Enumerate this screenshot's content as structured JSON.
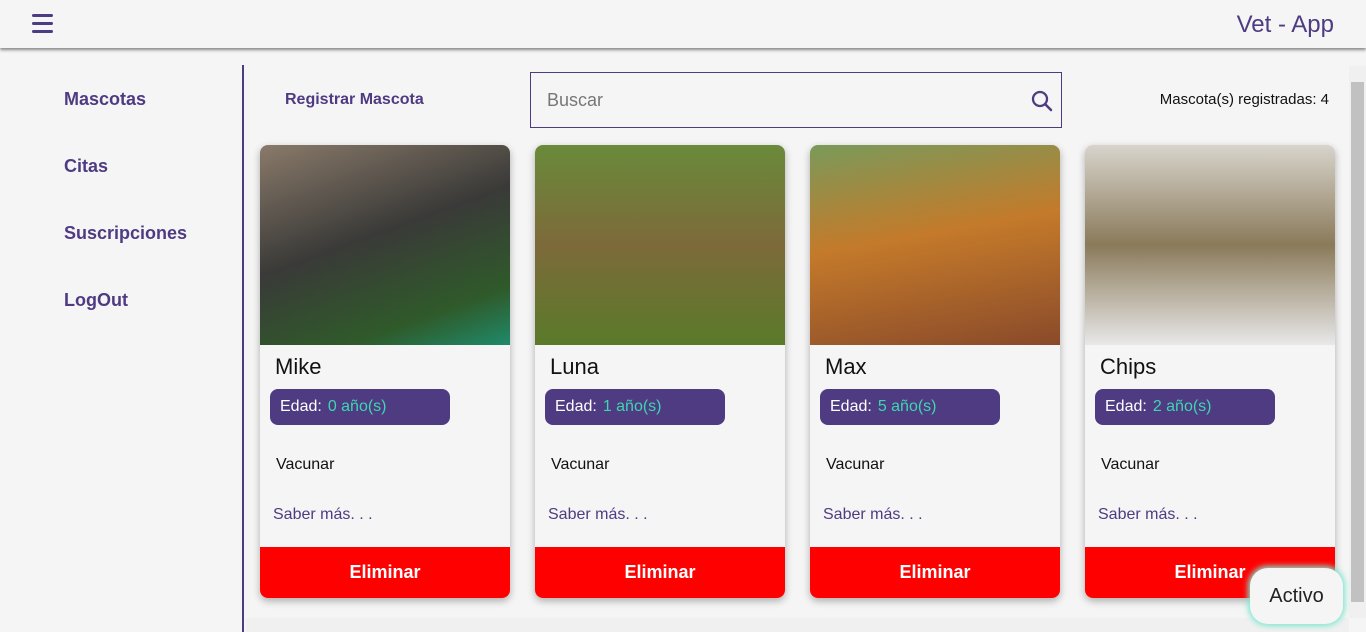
{
  "header": {
    "title": "Vet - App",
    "menu_icon": "hamburger-icon"
  },
  "sidebar": {
    "items": [
      {
        "label": "Mascotas"
      },
      {
        "label": "Citas"
      },
      {
        "label": "Suscripciones"
      },
      {
        "label": "LogOut"
      }
    ]
  },
  "toolbar": {
    "register_label": "Registrar Mascota",
    "search_placeholder": "Buscar",
    "search_value": "",
    "count_label": "Mascota(s) registradas: 4"
  },
  "pets": [
    {
      "name": "Mike",
      "age_label": "Edad:",
      "age": "0 año(s)",
      "vaccinate": "Vacunar",
      "more": "Saber más. . .",
      "delete": "Eliminar",
      "photo": "schnauzer puppy"
    },
    {
      "name": "Luna",
      "age_label": "Edad:",
      "age": "1 año(s)",
      "vaccinate": "Vacunar",
      "more": "Saber más. . .",
      "delete": "Eliminar",
      "photo": "beagle"
    },
    {
      "name": "Max",
      "age_label": "Edad:",
      "age": "5 año(s)",
      "vaccinate": "Vacunar",
      "more": "Saber más. . .",
      "delete": "Eliminar",
      "photo": "golden retriever"
    },
    {
      "name": "Chips",
      "age_label": "Edad:",
      "age": "2 año(s)",
      "vaccinate": "Vacunar",
      "more": "Saber más. . .",
      "delete": "Eliminar",
      "photo": "tabby cat"
    }
  ],
  "status_badge": "Activo",
  "colors": {
    "primary": "#4f3b82",
    "accent": "#3ed6b0",
    "danger": "#ff0000"
  }
}
